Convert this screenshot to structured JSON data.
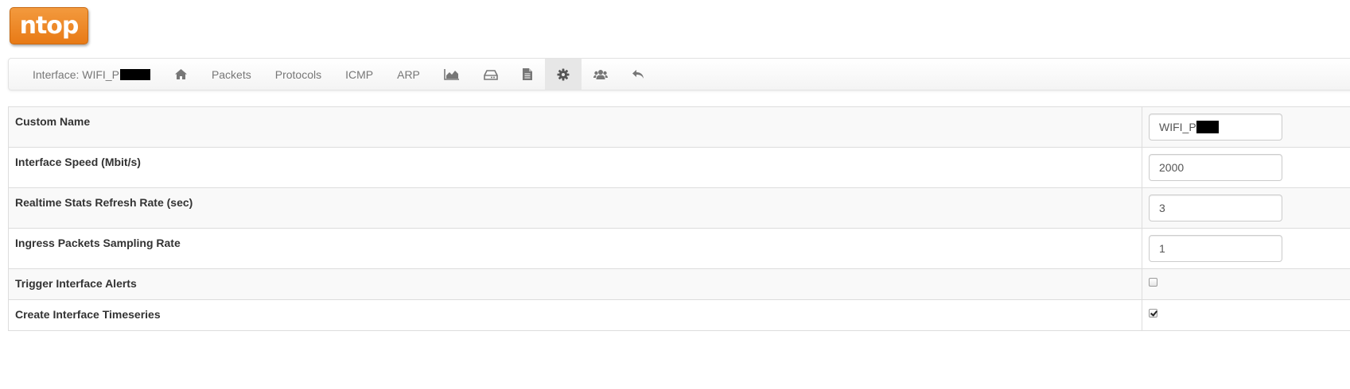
{
  "logo": {
    "text": "ntop",
    "color": "#f0891f"
  },
  "navbar": {
    "interface_label": "Interface: WIFI_P",
    "items": [
      {
        "name": "home-icon",
        "type": "icon"
      },
      {
        "label": "Packets"
      },
      {
        "label": "Protocols"
      },
      {
        "label": "ICMP"
      },
      {
        "label": "ARP"
      },
      {
        "name": "area-chart-icon",
        "type": "icon"
      },
      {
        "name": "hdd-icon",
        "type": "icon"
      },
      {
        "name": "file-text-icon",
        "type": "icon"
      },
      {
        "name": "gear-icon",
        "type": "icon",
        "active": true
      },
      {
        "name": "users-icon",
        "type": "icon"
      },
      {
        "name": "reply-icon",
        "type": "icon"
      }
    ]
  },
  "settings": {
    "rows": [
      {
        "label": "Custom Name",
        "type": "text",
        "value": "WIFI_P"
      },
      {
        "label": "Interface Speed (Mbit/s)",
        "type": "text",
        "value": "2000"
      },
      {
        "label": "Realtime Stats Refresh Rate (sec)",
        "type": "text",
        "value": "3"
      },
      {
        "label": "Ingress Packets Sampling Rate",
        "type": "text",
        "value": "1"
      },
      {
        "label": "Trigger Interface Alerts",
        "type": "checkbox",
        "checked": false
      },
      {
        "label": "Create Interface Timeseries",
        "type": "checkbox",
        "checked": true
      }
    ]
  }
}
